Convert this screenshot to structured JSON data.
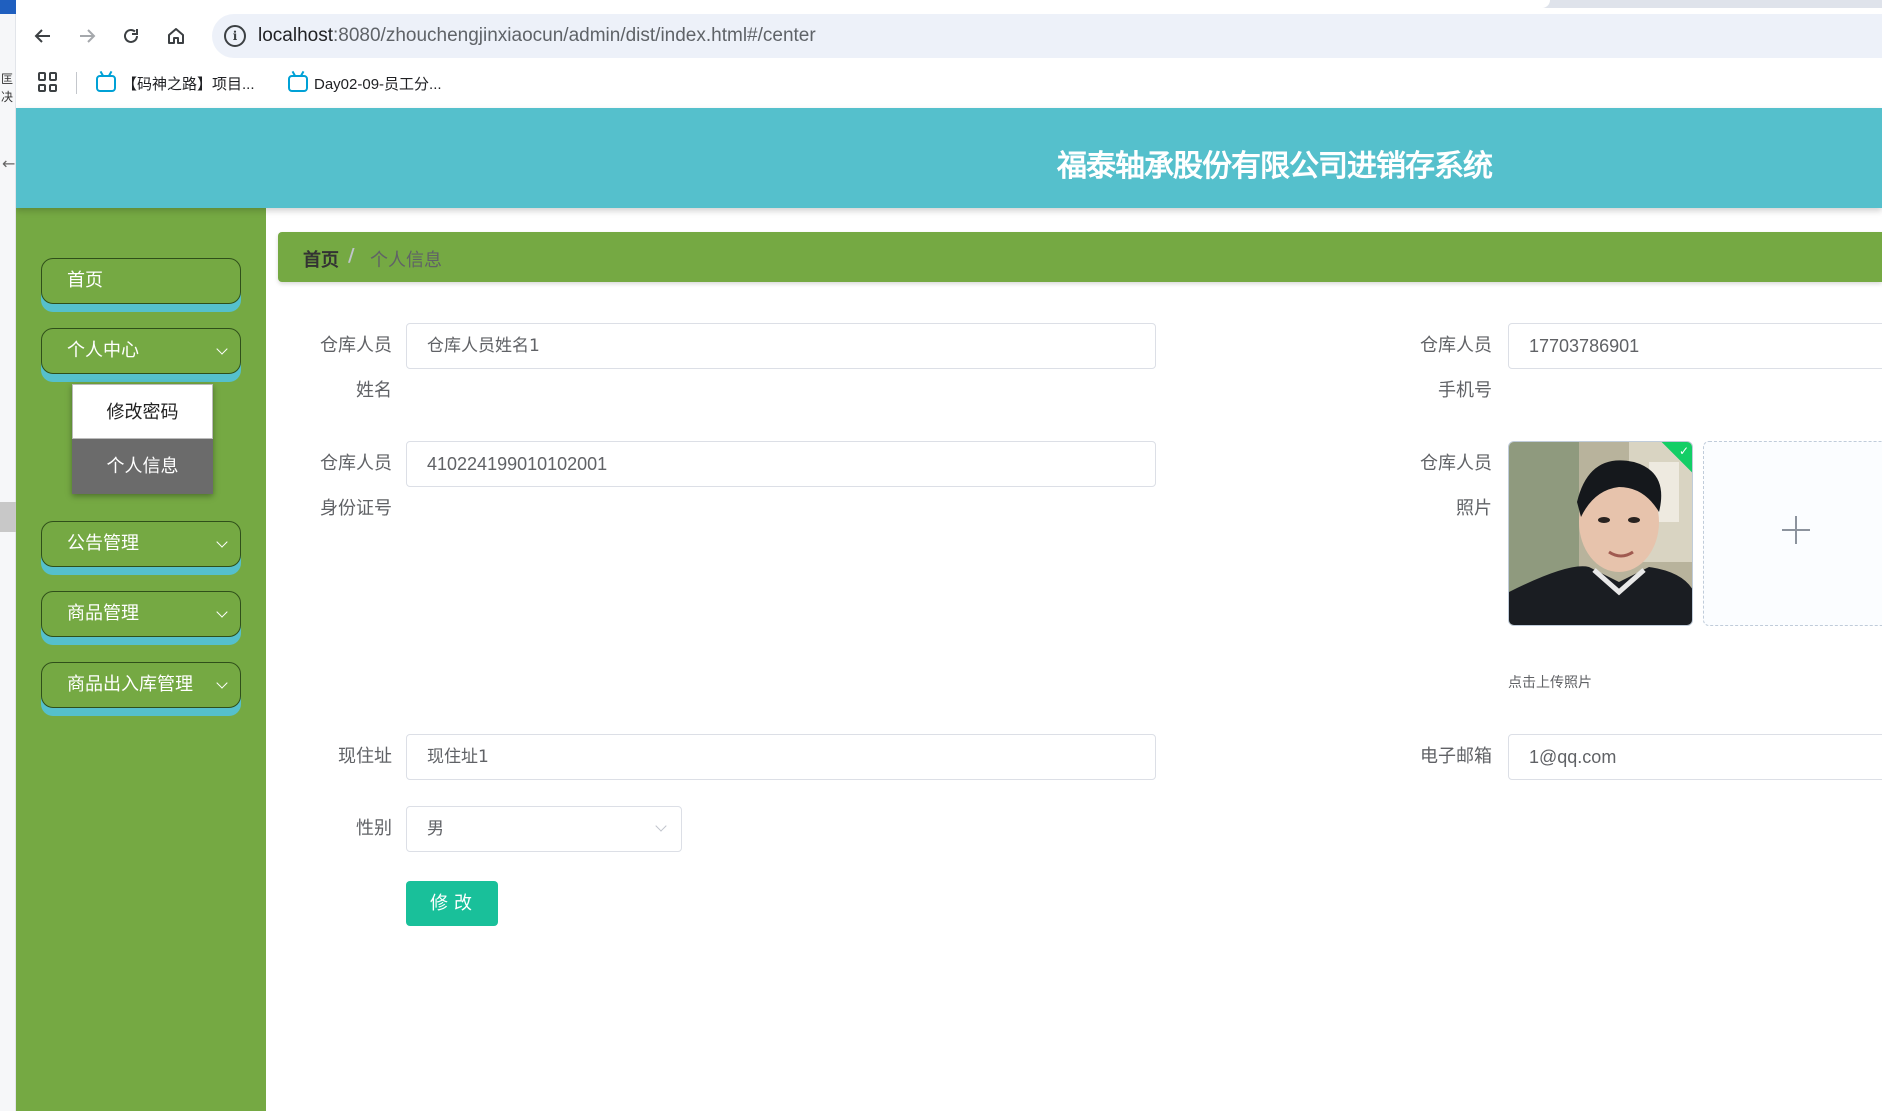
{
  "browser": {
    "url_host": "localhost",
    "url_path": ":8080/zhouchengjinxiaocun/admin/dist/index.html#/center",
    "bookmarks": [
      {
        "label": "【码神之路】项目..."
      },
      {
        "label": "Day02-09-员工分..."
      }
    ],
    "left_strip_text": [
      "匡",
      "决"
    ]
  },
  "header": {
    "title": "福泰轴承股份有限公司进销存系统"
  },
  "sidebar": {
    "items": [
      {
        "label": "首页"
      },
      {
        "label": "个人中心"
      },
      {
        "label": "公告管理"
      },
      {
        "label": "商品管理"
      },
      {
        "label": "商品出入库管理"
      }
    ],
    "submenu": [
      {
        "label": "修改密码"
      },
      {
        "label": "个人信息"
      }
    ]
  },
  "breadcrumb": {
    "home": "首页",
    "separator": "/",
    "current": "个人信息"
  },
  "form": {
    "name_label_1": "仓库人员",
    "name_label_2": "姓名",
    "name_value": "仓库人员姓名1",
    "phone_label_1": "仓库人员",
    "phone_label_2": "手机号",
    "phone_value": "17703786901",
    "id_label_1": "仓库人员",
    "id_label_2": "身份证号",
    "id_value": "410224199010102001",
    "photo_label_1": "仓库人员",
    "photo_label_2": "照片",
    "upload_tip": "点击上传照片",
    "address_label": "现住址",
    "address_value": "现住址1",
    "email_label": "电子邮箱",
    "email_value": "1@qq.com",
    "gender_label": "性别",
    "gender_value": "男",
    "submit_label": "修改"
  },
  "colors": {
    "header_bg": "#55c0cc",
    "sidebar_bg": "#75a943",
    "submit_bg": "#19c09a",
    "upload_success": "#13ce66"
  }
}
